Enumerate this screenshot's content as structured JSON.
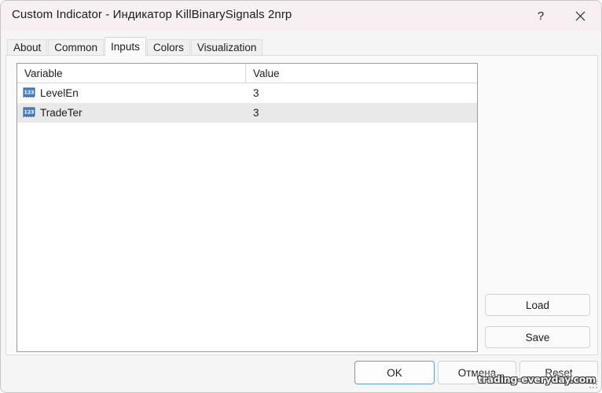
{
  "window": {
    "title": "Custom Indicator - Индикатор KillBinarySignals 2nrp",
    "help_label": "?",
    "close_label": "✕",
    "titlebar_color": "#f7eff2",
    "body_color": "#f5f5f5"
  },
  "tabs": [
    {
      "label": "About",
      "active": false
    },
    {
      "label": "Common",
      "active": false
    },
    {
      "label": "Inputs",
      "active": true
    },
    {
      "label": "Colors",
      "active": false
    },
    {
      "label": "Visualization",
      "active": false
    }
  ],
  "table": {
    "columns": [
      "Variable",
      "Value"
    ],
    "rows": [
      {
        "icon": "integer-123-icon",
        "variable": "LevelEn",
        "value": "3",
        "selected": false
      },
      {
        "icon": "integer-123-icon",
        "variable": "TradeTer",
        "value": "3",
        "selected": true
      }
    ]
  },
  "side_buttons": {
    "load": "Load",
    "save": "Save"
  },
  "footer_buttons": {
    "ok": "OK",
    "cancel": "Отмена",
    "reset": "Reset"
  },
  "watermark": {
    "text": "trading-everyday.com"
  },
  "colors": {
    "accent_focus": "#5aa0e0",
    "row_selected": "#e9e9e9",
    "icon_blue": "#4a86c8"
  }
}
